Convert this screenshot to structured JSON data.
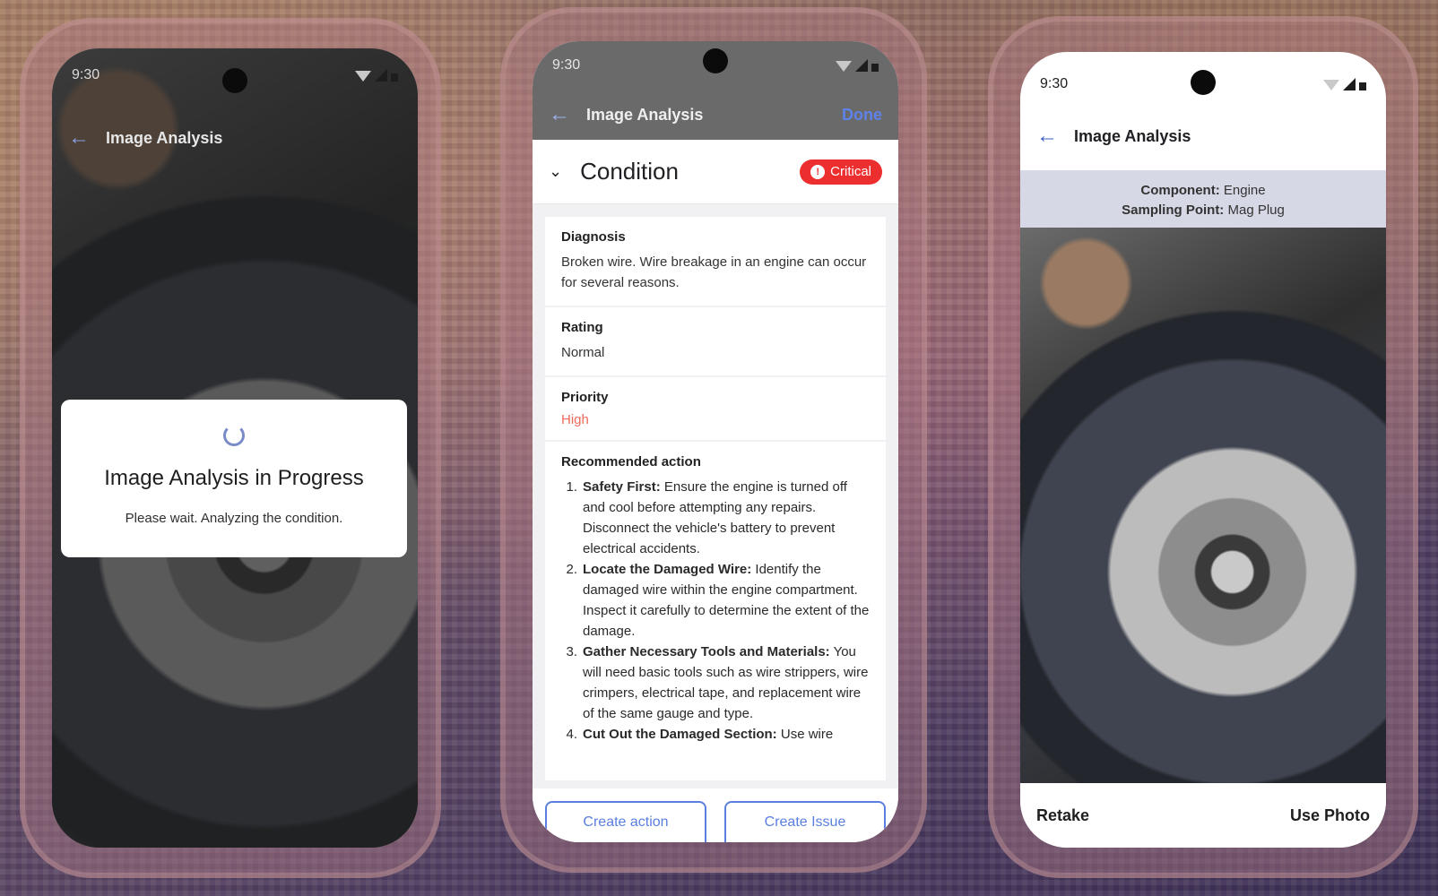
{
  "phones": {
    "progress": {
      "status_time": "9:30",
      "title": "Image Analysis",
      "dialog_title": "Image Analysis in Progress",
      "dialog_subtitle": "Please wait. Analyzing the condition."
    },
    "result": {
      "status_time": "9:30",
      "title": "Image Analysis",
      "done_label": "Done",
      "section_title": "Condition",
      "badge_label": "Critical",
      "badge_color": "#ec2e2e",
      "diagnosis_label": "Diagnosis",
      "diagnosis_text": "Broken wire. Wire breakage in an engine can occur for several reasons.",
      "rating_label": "Rating",
      "rating_value": "Normal",
      "priority_label": "Priority",
      "priority_value": "High",
      "priority_color": "#ef6a5a",
      "recommended_label": "Recommended action",
      "recommended_items": [
        {
          "num": "1.",
          "bold": "Safety First:",
          "text": " Ensure the engine is turned off and cool before attempting any repairs. Disconnect the vehicle's battery to prevent electrical accidents."
        },
        {
          "num": "2.",
          "bold": "Locate the Damaged Wire:",
          "text": " Identify the damaged wire within the engine compartment. Inspect it carefully to determine the extent of the damage."
        },
        {
          "num": "3.",
          "bold": "Gather Necessary Tools and Materials:",
          "text": " You will need basic tools such as wire strippers, wire crimpers, electrical tape, and replacement wire of the same gauge and type."
        },
        {
          "num": "4.",
          "bold": "Cut Out the Damaged Section:",
          "text": " Use wire"
        }
      ],
      "create_action_label": "Create action",
      "create_issue_label": "Create Issue",
      "accent_color": "#5b7fe0"
    },
    "camera": {
      "status_time": "9:30",
      "title": "Image Analysis",
      "component_label": "Component:",
      "component_value": " Engine",
      "sampling_label": "Sampling Point:",
      "sampling_value": " Mag Plug",
      "retake_label": "Retake",
      "use_photo_label": "Use Photo"
    }
  },
  "icons": [
    "back-arrow-icon",
    "signal-icon",
    "wifi-icon",
    "battery-icon",
    "spinner-icon",
    "chevron-down-icon",
    "alert-icon"
  ]
}
